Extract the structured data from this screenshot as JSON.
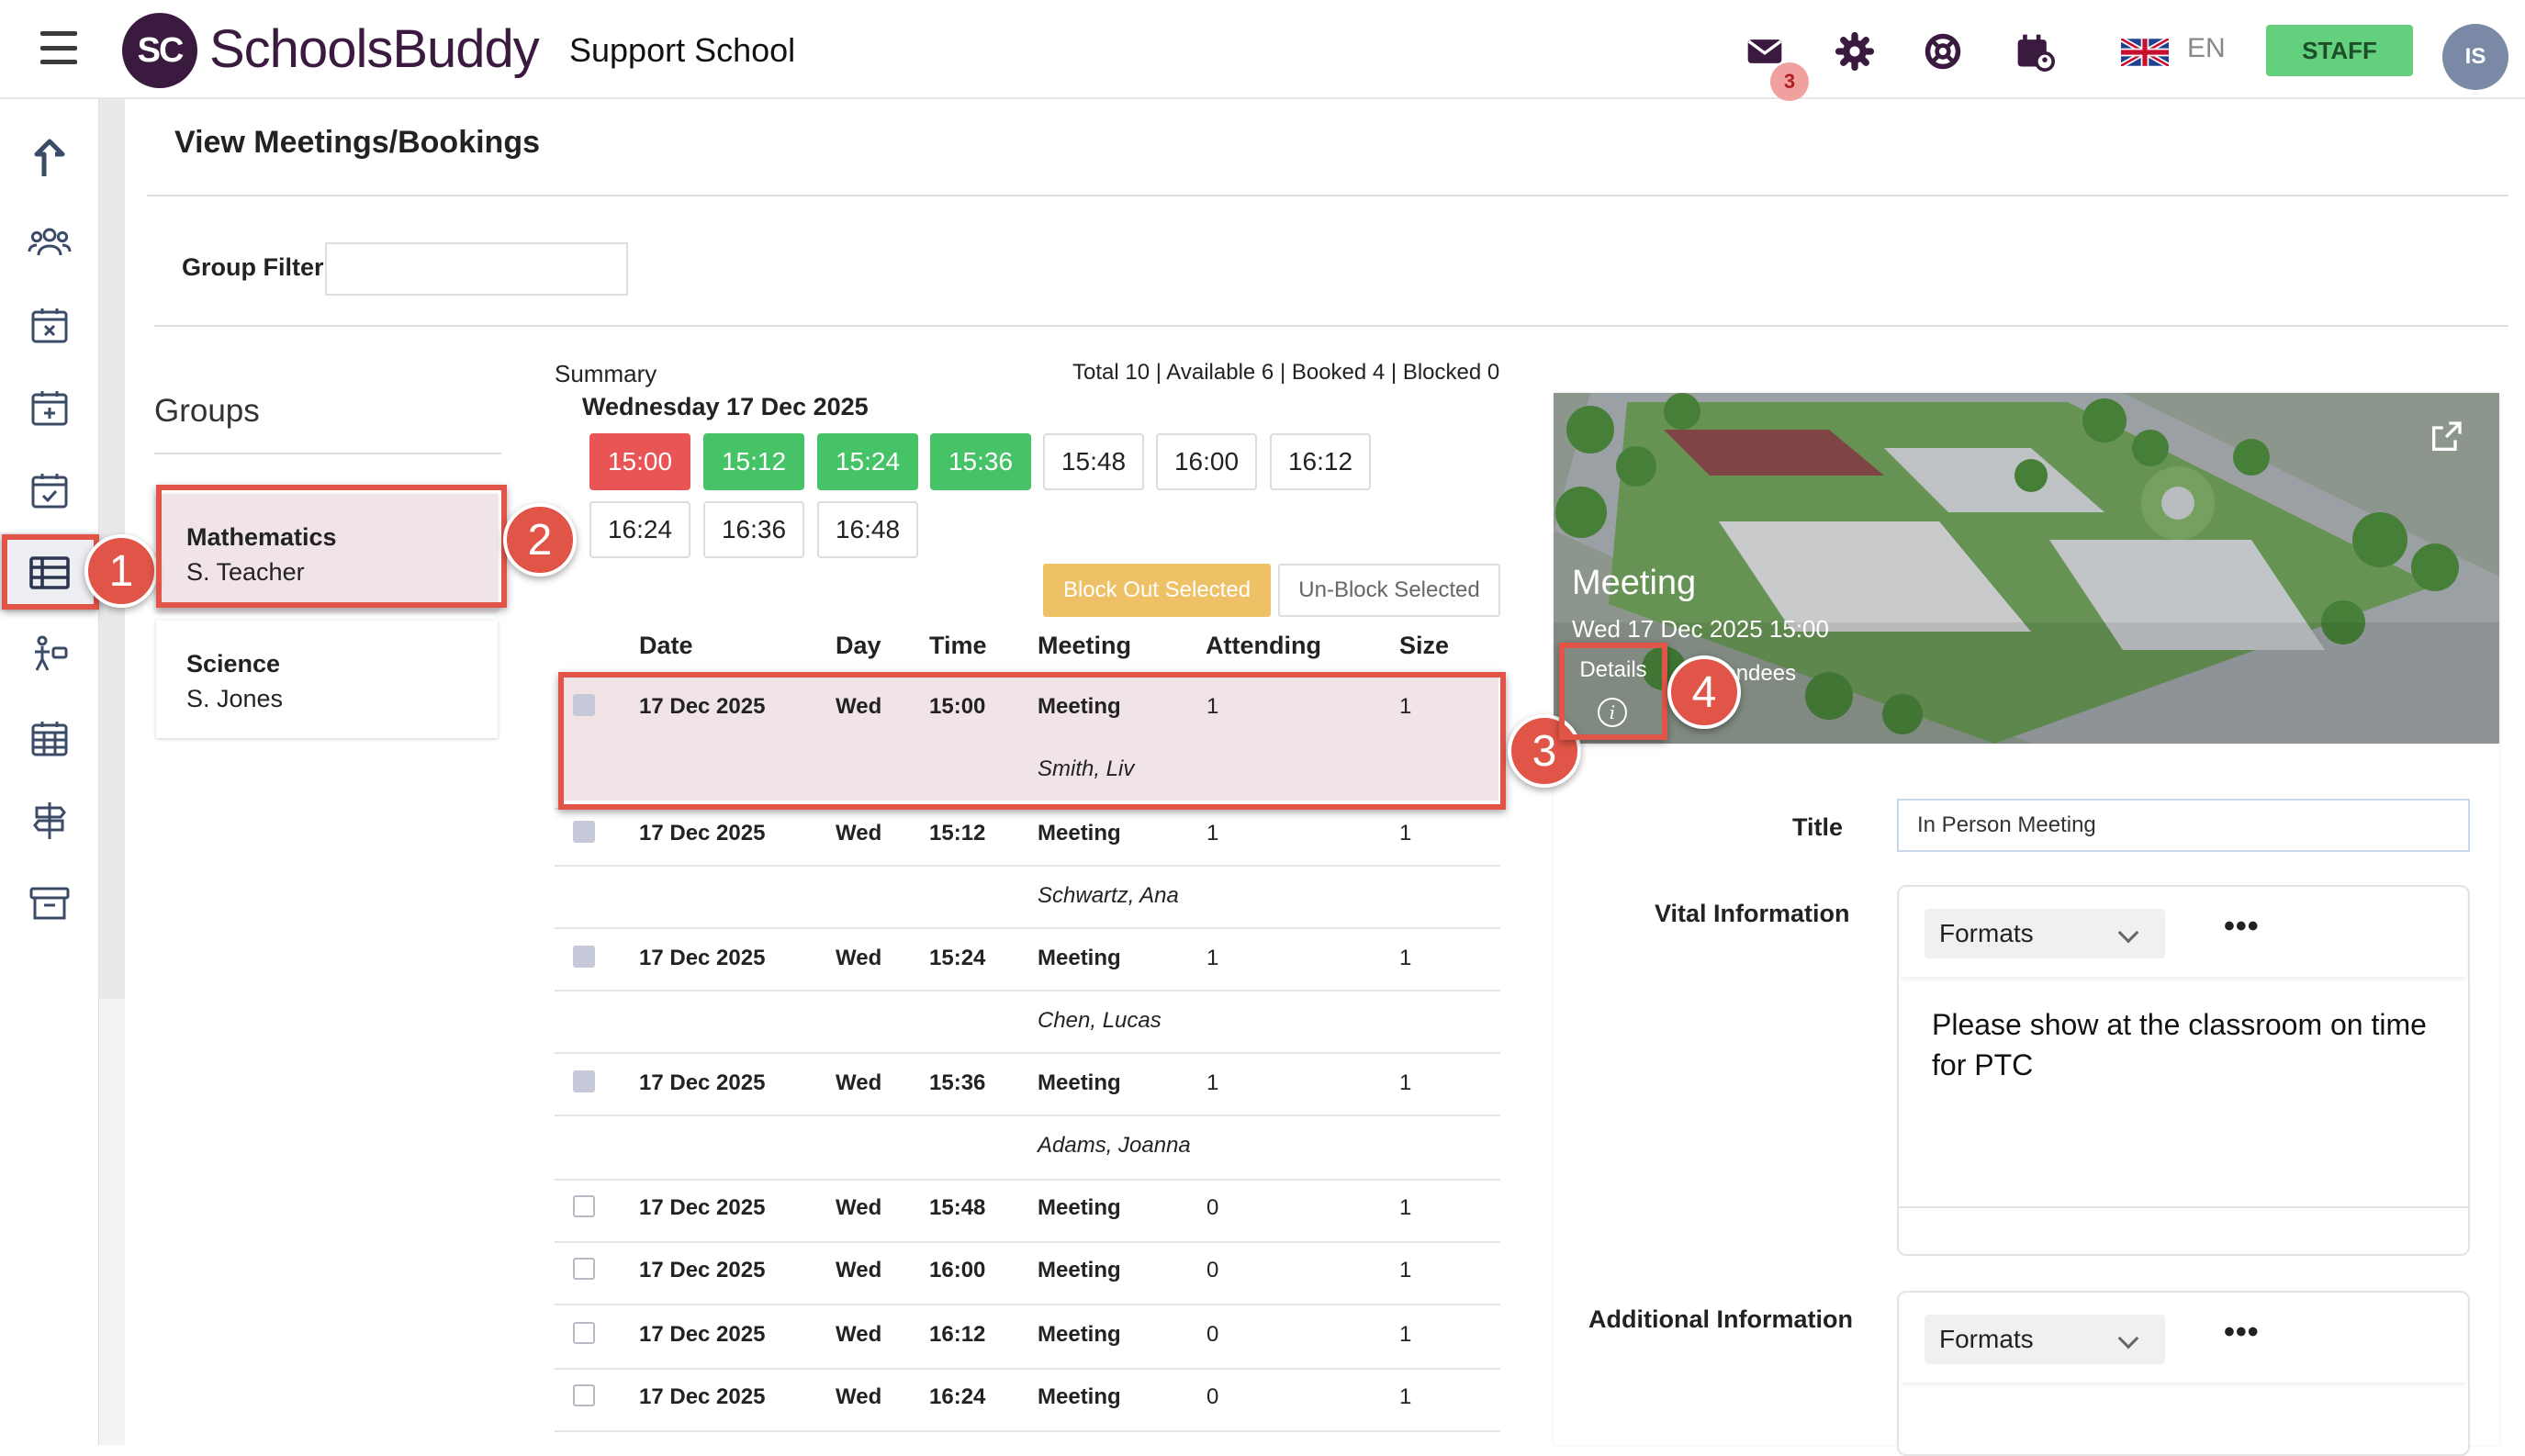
{
  "app": {
    "brand": "SchoolsBuddy",
    "logo_text": "SC",
    "school": "Support School"
  },
  "header": {
    "mail_count": "3",
    "language": "EN",
    "staff_label": "STAFF",
    "user_initials": "IS"
  },
  "page": {
    "title": "View Meetings/Bookings",
    "group_filter_label": "Group Filter",
    "group_filter_value": ""
  },
  "groups": {
    "title": "Groups",
    "items": [
      {
        "name": "Mathematics",
        "teacher": "S. Teacher"
      },
      {
        "name": "Science",
        "teacher": "S. Jones"
      }
    ]
  },
  "summary": {
    "label": "Summary",
    "totals": "Total 10 | Available 6 | Booked 4 | Blocked 0",
    "date": "Wednesday 17 Dec 2025",
    "slots": [
      "15:00",
      "15:12",
      "15:24",
      "15:36",
      "15:48",
      "16:00",
      "16:12",
      "16:24",
      "16:36",
      "16:48"
    ],
    "block_out_label": "Block Out Selected",
    "unblock_label": "Un-Block Selected"
  },
  "table": {
    "headers": [
      "Date",
      "Day",
      "Time",
      "Meeting",
      "Attending",
      "Size"
    ],
    "rows": [
      {
        "date": "17 Dec 2025",
        "day": "Wed",
        "time": "15:00",
        "meeting": "Meeting",
        "attending": "1",
        "size": "1",
        "attendee": "Smith, Liv"
      },
      {
        "date": "17 Dec 2025",
        "day": "Wed",
        "time": "15:12",
        "meeting": "Meeting",
        "attending": "1",
        "size": "1",
        "attendee": "Schwartz, Ana"
      },
      {
        "date": "17 Dec 2025",
        "day": "Wed",
        "time": "15:24",
        "meeting": "Meeting",
        "attending": "1",
        "size": "1",
        "attendee": "Chen, Lucas"
      },
      {
        "date": "17 Dec 2025",
        "day": "Wed",
        "time": "15:36",
        "meeting": "Meeting",
        "attending": "1",
        "size": "1",
        "attendee": "Adams, Joanna"
      },
      {
        "date": "17 Dec 2025",
        "day": "Wed",
        "time": "15:48",
        "meeting": "Meeting",
        "attending": "0",
        "size": "1",
        "attendee": ""
      },
      {
        "date": "17 Dec 2025",
        "day": "Wed",
        "time": "16:00",
        "meeting": "Meeting",
        "attending": "0",
        "size": "1",
        "attendee": ""
      },
      {
        "date": "17 Dec 2025",
        "day": "Wed",
        "time": "16:12",
        "meeting": "Meeting",
        "attending": "0",
        "size": "1",
        "attendee": ""
      },
      {
        "date": "17 Dec 2025",
        "day": "Wed",
        "time": "16:24",
        "meeting": "Meeting",
        "attending": "0",
        "size": "1",
        "attendee": ""
      }
    ]
  },
  "detail": {
    "banner_title": "Meeting",
    "banner_subtitle": "Wed 17 Dec 2025 15:00",
    "details_tab": "Details",
    "attendees_tab": "Attendees",
    "title_label": "Title",
    "title_value": "In Person Meeting",
    "vital_label": "Vital Information",
    "vital_text": "Please show at the classroom on time for PTC",
    "additional_label": "Additional Information",
    "formats_label": "Formats",
    "more_label": "•••"
  },
  "callouts": [
    "1",
    "2",
    "3",
    "4"
  ],
  "colors": {
    "accent_red": "#e05547",
    "slot_red": "#e95454",
    "slot_green": "#47c367",
    "staff_green": "#63d07e",
    "brand_purple": "#3b1a3f",
    "selected_bg": "#f1e4e6",
    "block_btn": "#eec167"
  }
}
